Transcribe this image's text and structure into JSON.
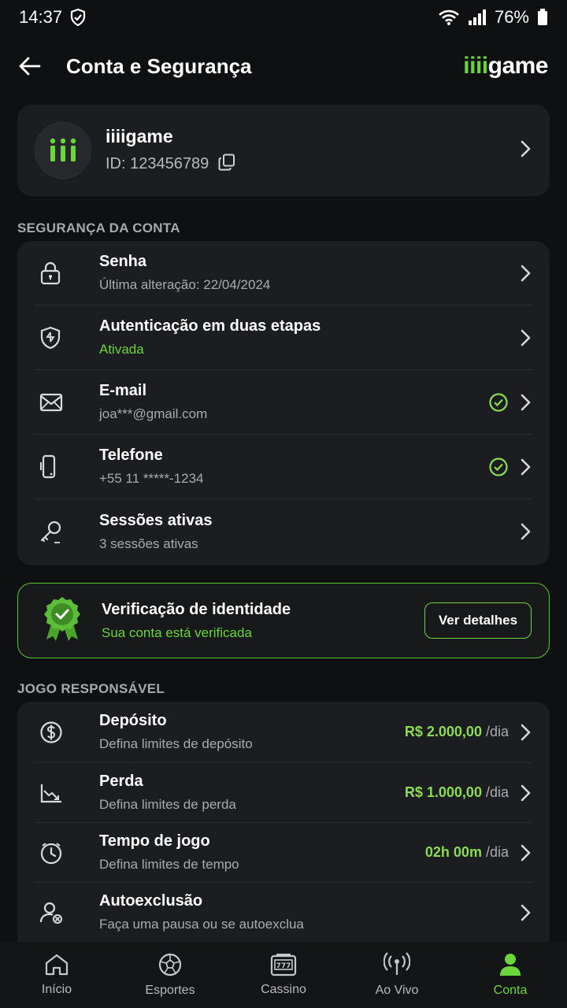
{
  "status_bar": {
    "time": "14:37",
    "battery": "76%"
  },
  "header": {
    "title": "Conta e Segurança",
    "brand_green": "iiii",
    "brand_white": "game"
  },
  "profile": {
    "name": "iiiigame",
    "id_text": "ID: 123456789"
  },
  "security": {
    "section_label": "SEGURANÇA DA CONTA",
    "items": [
      {
        "title": "Senha",
        "subtitle": "Última alteração: 22/04/2024",
        "icon": "lock-icon"
      },
      {
        "title": "Autenticação em duas etapas",
        "subtitle": "Ativada",
        "icon": "shield-icon"
      },
      {
        "title": "E-mail",
        "subtitle": "joa***@gmail.com",
        "icon": "mail-icon",
        "verified": true
      },
      {
        "title": "Telefone",
        "subtitle": "+55 11 *****-1234",
        "icon": "phone-icon",
        "verified": true
      },
      {
        "title": "Sessões ativas",
        "subtitle": "3 sessões ativas",
        "icon": "key-icon"
      }
    ]
  },
  "verification": {
    "title": "Verificação de identidade",
    "subtitle": "Sua conta está verificada",
    "button": "Ver detalhes"
  },
  "responsible": {
    "section_label": "JOGO RESPONSÁVEL",
    "items": [
      {
        "title": "Depósito",
        "subtitle": "Defina limites de depósito",
        "value": "R$ 2.000,00",
        "unit": "/dia",
        "icon": "dollar-icon"
      },
      {
        "title": "Perda",
        "subtitle": "Defina limites de perda",
        "value": "R$ 1.000,00",
        "unit": "/dia",
        "icon": "chart-down-icon"
      },
      {
        "title": "Tempo de jogo",
        "subtitle": "Defina limites de tempo",
        "value": "02h 00m",
        "unit": "/dia",
        "icon": "clock-icon"
      },
      {
        "title": "Autoexclusão",
        "subtitle": "Faça uma pausa ou se autoexclua",
        "icon": "user-block-icon"
      }
    ]
  },
  "nav": {
    "items": [
      {
        "label": "Início",
        "icon": "home-icon"
      },
      {
        "label": "Esportes",
        "icon": "ball-icon"
      },
      {
        "label": "Cassino",
        "icon": "slot-icon"
      },
      {
        "label": "Ao Vivo",
        "icon": "broadcast-icon"
      },
      {
        "label": "Conta",
        "icon": "user-icon",
        "active": true
      }
    ]
  },
  "colors": {
    "accent": "#6ad63b",
    "background": "#0f1012",
    "card": "#1c1d20"
  }
}
